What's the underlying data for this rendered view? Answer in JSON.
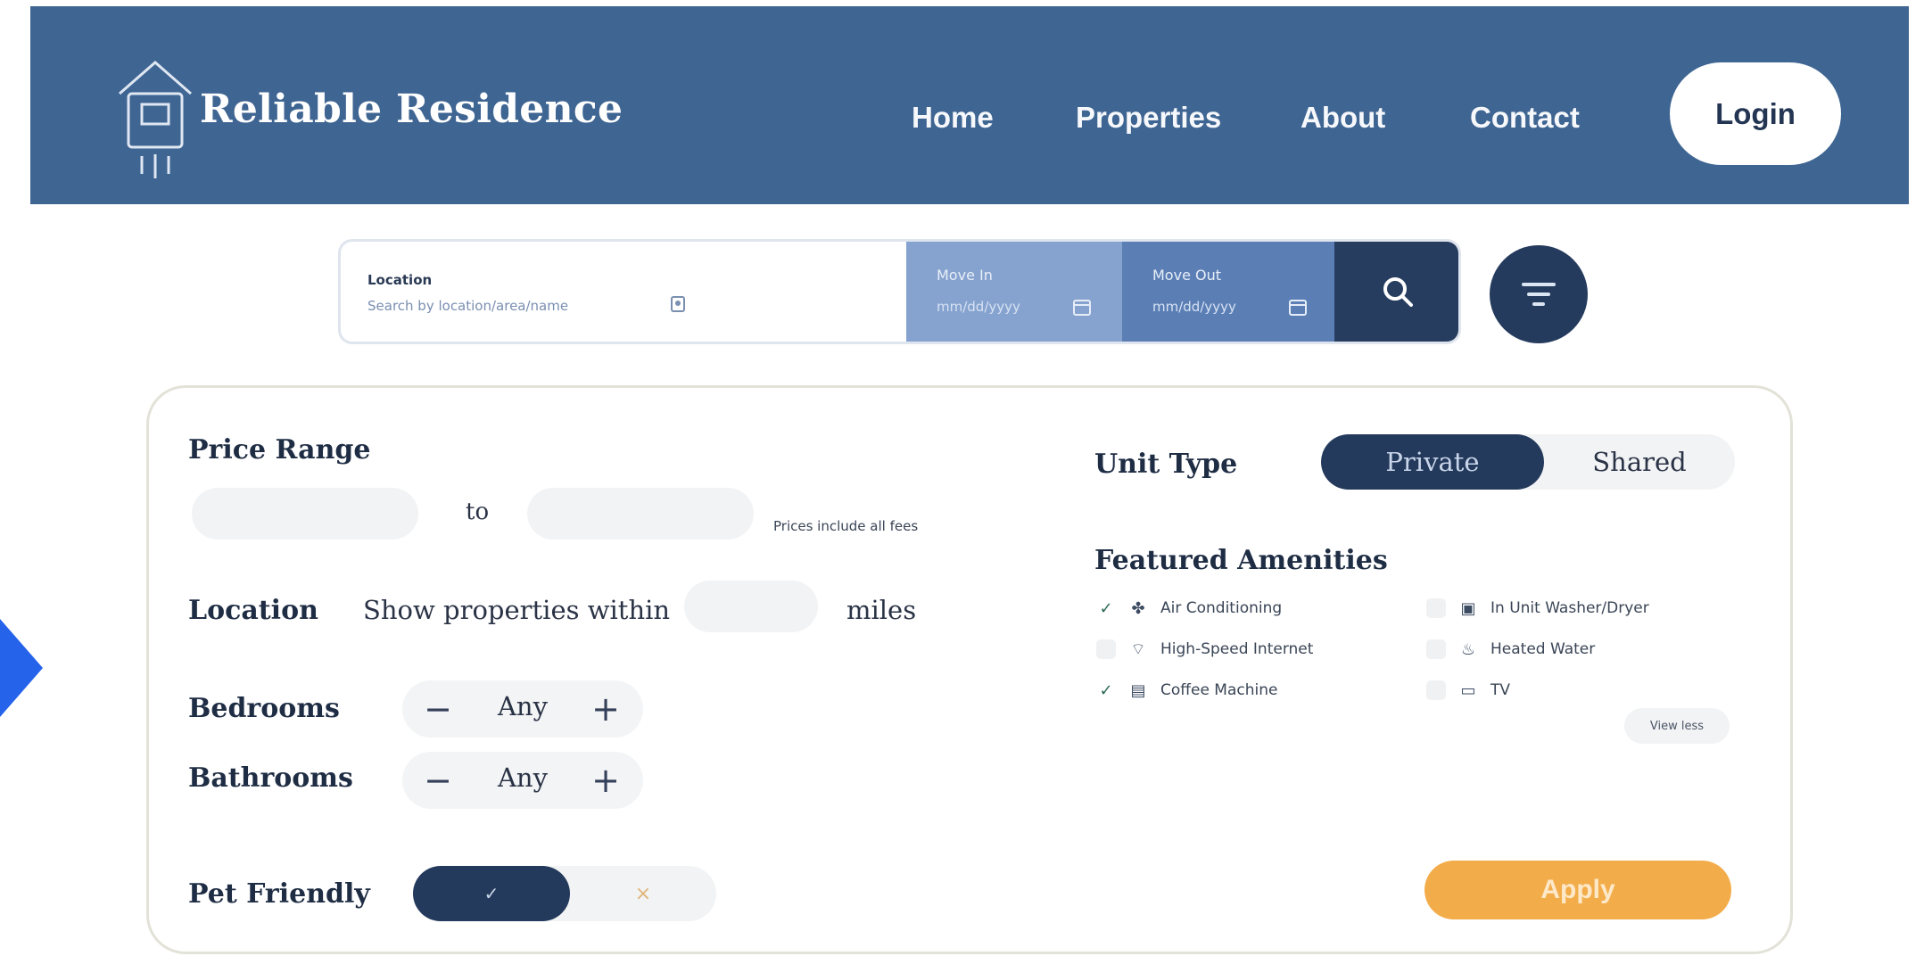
{
  "header": {
    "brand": "Reliable Residence",
    "nav": [
      "Home",
      "Properties",
      "About",
      "Contact"
    ],
    "login_label": "Login"
  },
  "search": {
    "location_label": "Location",
    "location_placeholder": "Search by location/area/name",
    "move_in_label": "Move In",
    "move_in_value": "mm/dd/yyyy",
    "move_out_label": "Move Out",
    "move_out_value": "mm/dd/yyyy"
  },
  "filters": {
    "price_range_label": "Price Range",
    "price_to": "to",
    "price_note": "Prices include all fees",
    "location_label": "Location",
    "location_prefix": "Show properties within",
    "location_suffix": "miles",
    "bedrooms_label": "Bedrooms",
    "bedrooms_value": "Any",
    "bathrooms_label": "Bathrooms",
    "bathrooms_value": "Any",
    "pet_label": "Pet Friendly",
    "pet_yes": "✓",
    "pet_no": "×",
    "unit_type_label": "Unit Type",
    "unit_private": "Private",
    "unit_shared": "Shared",
    "amenities_label": "Featured Amenities",
    "amenities": [
      {
        "label": "Air Conditioning",
        "checked": true,
        "icon": "fan-icon"
      },
      {
        "label": "In Unit Washer/Dryer",
        "checked": false,
        "icon": "washer-icon"
      },
      {
        "label": "High-Speed Internet",
        "checked": false,
        "icon": "wifi-icon"
      },
      {
        "label": "Heated Water",
        "checked": false,
        "icon": "water-heater-icon"
      },
      {
        "label": "Coffee Machine",
        "checked": true,
        "icon": "coffee-machine-icon"
      },
      {
        "label": "TV",
        "checked": false,
        "icon": "tv-icon"
      }
    ],
    "view_less_label": "View less",
    "apply_label": "Apply"
  },
  "colors": {
    "header_bg": "#3f6593",
    "primary_dark": "#243a5c",
    "apply_orange": "#f3ac4a"
  }
}
